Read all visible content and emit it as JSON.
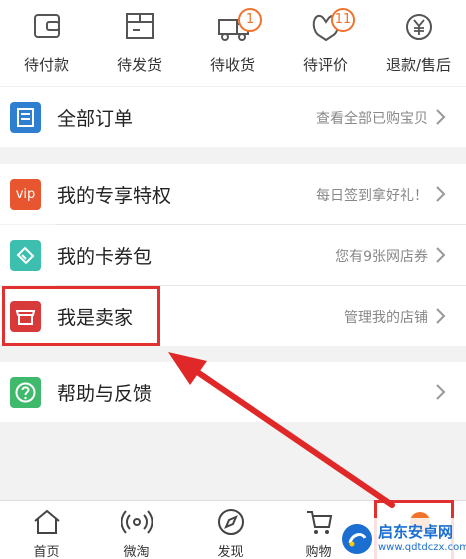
{
  "order_status": [
    {
      "label": "待付款",
      "icon": "wallet-icon",
      "badge": ""
    },
    {
      "label": "待发货",
      "icon": "package-icon",
      "badge": ""
    },
    {
      "label": "待收货",
      "icon": "truck-icon",
      "badge": "1"
    },
    {
      "label": "待评价",
      "icon": "comment-icon",
      "badge": "11"
    },
    {
      "label": "退款/售后",
      "icon": "refund-icon",
      "badge": ""
    }
  ],
  "all_orders": {
    "title": "全部订单",
    "hint": "查看全部已购宝贝",
    "icon": "list-icon",
    "color": "#2f7fd0"
  },
  "menu": [
    {
      "title": "我的专享特权",
      "hint": "每日签到拿好礼！",
      "icon_text": "vip",
      "icon": "vip-icon",
      "color": "#e8562f"
    },
    {
      "title": "我的卡券包",
      "hint": "您有9张网店券",
      "icon": "coupon-icon",
      "color": "#3dbfb0"
    },
    {
      "title": "我是卖家",
      "hint": "管理我的店铺",
      "icon": "shop-icon",
      "color": "#d83a3a"
    }
  ],
  "help": {
    "title": "帮助与反馈",
    "hint": "",
    "icon": "help-icon",
    "color": "#3fb96b"
  },
  "tabbar": [
    {
      "label": "首页",
      "icon": "home-icon"
    },
    {
      "label": "微淘",
      "icon": "signal-icon"
    },
    {
      "label": "发现",
      "icon": "compass-icon"
    },
    {
      "label": "购物",
      "icon": "cart-icon"
    },
    {
      "label": "",
      "icon": "profile-icon"
    }
  ],
  "watermark": {
    "title": "启东安卓网",
    "url": "www.qdtdczx.com"
  }
}
